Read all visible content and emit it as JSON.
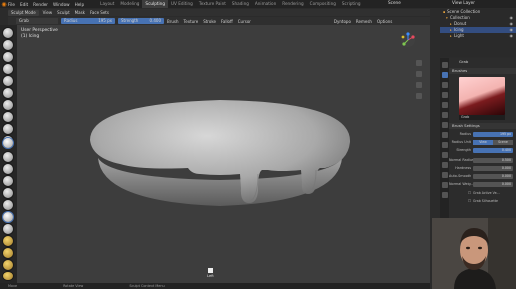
{
  "topbar": {
    "menus": [
      "File",
      "Edit",
      "Render",
      "Window",
      "Help"
    ],
    "workspaces": [
      "Layout",
      "Modeling",
      "Sculpting",
      "UV Editing",
      "Texture Paint",
      "Shading",
      "Animation",
      "Rendering",
      "Compositing",
      "Scripting"
    ],
    "active_workspace": "Sculpting",
    "scene": "Scene",
    "view_layer": "View Layer"
  },
  "header": {
    "mode": "Sculpt Mode",
    "menus": [
      "View",
      "Sculpt",
      "Mask",
      "Face Sets"
    ],
    "brush": "Grab",
    "radius_label": "Radius",
    "radius_value": "195 px",
    "strength_label": "Strength",
    "strength_value": "0.400",
    "dropdowns": [
      "Brush",
      "Texture",
      "Stroke",
      "Falloff",
      "Cursor"
    ],
    "right_items": [
      "Dyntopo",
      "Remesh",
      "Options"
    ]
  },
  "viewport": {
    "view": "User Perspective",
    "object": "(1) Icing",
    "side_label": "Left"
  },
  "outliner": {
    "rows": [
      "Scene Collection",
      "Collection",
      "Donut",
      "Icing",
      "Light"
    ]
  },
  "properties": {
    "brush_name": "Grab",
    "brushes_label": "Brushes",
    "preview_name": "Grab",
    "settings_label": "Brush Settings",
    "radius_label": "Radius",
    "radius_value": "195 px",
    "radius_unit_label": "Radius Unit",
    "radius_unit_options": [
      "View",
      "Scene"
    ],
    "strength_label": "Strength",
    "strength_value": "0.400",
    "normal_radius_label": "Normal Radius",
    "normal_radius_value": "0.500",
    "hardness_label": "Hardness",
    "hardness_value": "0.000",
    "auto_smooth_label": "Auto-Smooth",
    "auto_smooth_value": "0.000",
    "normal_weight_label": "Normal Weig...",
    "normal_weight_value": "0.000",
    "grab_active_label": "Grab Active Ve...",
    "silhouette_label": "Grab Silhouette"
  },
  "statusbar": {
    "items": [
      "Move",
      "Rotate View",
      "Sculpt Context Menu"
    ]
  },
  "colors": {
    "accent": "#4772b3",
    "viewport_bg": "#3d3d3d",
    "mesh": "#b4b4b4"
  }
}
